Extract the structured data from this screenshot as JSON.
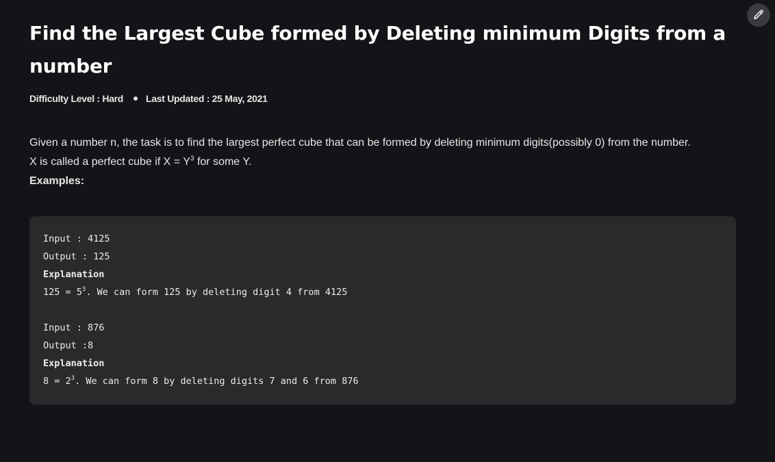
{
  "article": {
    "title": "Find the Largest Cube formed by Deleting minimum Digits from a number",
    "difficulty": "Difficulty Level : Hard",
    "last_updated": "Last Updated : 25 May, 2021",
    "intro": "Given a number n, the task is to find the largest perfect cube that can be formed by deleting minimum digits(possibly 0) from the number.",
    "cube_def_prefix": "X is called a perfect cube if X = Y",
    "cube_def_exp": "3",
    "cube_def_suffix": " for some Y.",
    "examples_label": "Examples:"
  },
  "examples": [
    {
      "input": "Input : 4125",
      "output": "Output : 125",
      "explanation_label": "Explanation",
      "expl_prefix": "125 = 5",
      "expl_exp": "3",
      "expl_suffix": ". We can form 125 by deleting digit 4 from 4125"
    },
    {
      "input": "Input : 876",
      "output": "Output :8",
      "explanation_label": "Explanation",
      "expl_prefix": "8 = 2",
      "expl_exp": "3",
      "expl_suffix": ". We can form 8 by deleting digits 7 and 6 from 876"
    }
  ],
  "icons": {
    "edit": "pencil-icon"
  },
  "colors": {
    "background": "#131417",
    "code_background": "#2a2a2c",
    "edit_button": "#3a3b3e"
  }
}
